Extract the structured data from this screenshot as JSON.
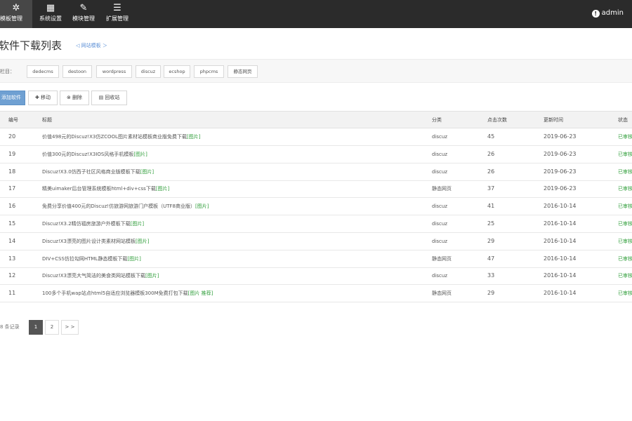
{
  "header": {
    "nav": [
      {
        "icon": "gear-icon",
        "glyph": "✲",
        "label": "模板管理"
      },
      {
        "icon": "grid-icon",
        "glyph": "▦",
        "label": "系统设置"
      },
      {
        "icon": "wrench-icon",
        "glyph": "✎",
        "label": "模块管理"
      },
      {
        "icon": "list-icon",
        "glyph": "☰",
        "label": "扩展管理"
      }
    ],
    "admin": "admin"
  },
  "page": {
    "title": "软件下载列表",
    "breadcrumb": "◁ 网站模板 ＞"
  },
  "filter": {
    "label": "栏目：",
    "tags": [
      "dedecms",
      "destoon",
      "wordpress",
      "discuz",
      "ecshop",
      "phpcms",
      "静态网页"
    ]
  },
  "toolbar": {
    "add": "添加软件",
    "move": "✚ 移动",
    "delete": "⊗ 删除",
    "recycle": "▤ 回收站"
  },
  "table": {
    "headers": {
      "id": "编号",
      "title": "标题",
      "category": "分类",
      "clicks": "点击次数",
      "updated": "更新时间",
      "status": "状态"
    },
    "rows": [
      {
        "id": "20",
        "title": "价值498元的Discuz!X3仿ZCOOL图片素材站模板商业版免费下载",
        "tag": "[图片]",
        "category": "discuz",
        "clicks": "45",
        "updated": "2019-06-23",
        "status": "已审核"
      },
      {
        "id": "19",
        "title": "价值300元的Discuz!X3IOS风格手机模板",
        "tag": "[图片]",
        "category": "discuz",
        "clicks": "26",
        "updated": "2019-06-23",
        "status": "已审核"
      },
      {
        "id": "18",
        "title": "Discuz!X3.0仿西子社区风格商业版模板下载",
        "tag": "[图片]",
        "category": "discuz",
        "clicks": "26",
        "updated": "2019-06-23",
        "status": "已审核"
      },
      {
        "id": "17",
        "title": "精美uimaker后台管理系统模板html+div+css下载",
        "tag": "[图片]",
        "category": "静态网页",
        "clicks": "37",
        "updated": "2019-06-23",
        "status": "已审核"
      },
      {
        "id": "16",
        "title": "免费分享价值400元的Discuz!仿旅游网旅游门户模板（UTF8商业版）",
        "tag": "[图片]",
        "category": "discuz",
        "clicks": "41",
        "updated": "2016-10-14",
        "status": "已审核"
      },
      {
        "id": "15",
        "title": "Discuz!X3.2精仿福房旅游户外模板下载",
        "tag": "[图片]",
        "category": "discuz",
        "clicks": "25",
        "updated": "2016-10-14",
        "status": "已审核"
      },
      {
        "id": "14",
        "title": "Discuz!X3漂亮的图片设计类素材网站模板",
        "tag": "[图片]",
        "category": "discuz",
        "clicks": "29",
        "updated": "2016-10-14",
        "status": "已审核"
      },
      {
        "id": "13",
        "title": "DIV+CSS仿拉勾网HTML静态模板下载",
        "tag": "[图片]",
        "category": "静态网页",
        "clicks": "47",
        "updated": "2016-10-14",
        "status": "已审核"
      },
      {
        "id": "12",
        "title": "Discuz!X3漂亮大气简洁的美食类网站模板下载",
        "tag": "[图片]",
        "category": "discuz",
        "clicks": "33",
        "updated": "2016-10-14",
        "status": "已审核"
      },
      {
        "id": "11",
        "title": "100多个手机wap站点html5自适应浏览器模板300M免费打包下载",
        "tag": "[图片 推荐]",
        "category": "静态网页",
        "clicks": "29",
        "updated": "2016-10-14",
        "status": "已审核"
      }
    ]
  },
  "pagination": {
    "total": "8 条记录",
    "pages": [
      "1",
      "2"
    ],
    "next": "> >"
  }
}
